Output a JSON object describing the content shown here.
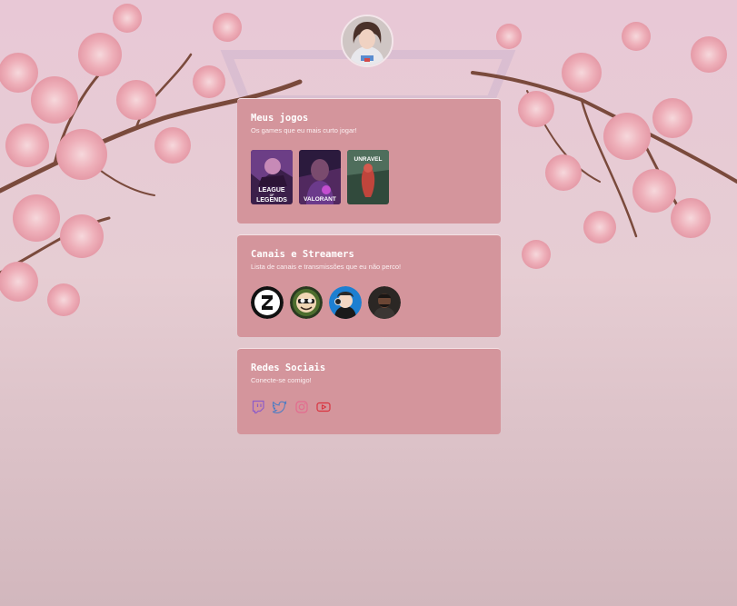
{
  "colors": {
    "card_bg": "#d4959c",
    "page_bg": "#d4b8bf",
    "twitch": "#8d5cc8",
    "twitter": "#4a7cc4",
    "instagram": "#e36b8e",
    "youtube": "#d9343f"
  },
  "profile": {
    "avatar_icon": "profile-avatar"
  },
  "games_card": {
    "title": "Meus jogos",
    "subtitle": "Os games que eu mais curto jogar!",
    "games": [
      {
        "name": "League of Legends",
        "logo_line1": "LEAGUE",
        "logo_line2": "LEGENDS",
        "logo_small": "OF"
      },
      {
        "name": "Valorant",
        "logo": "VALORANT"
      },
      {
        "name": "Unravel",
        "logo": "UNRAVEL"
      }
    ]
  },
  "streamers_card": {
    "title": "Canais e Streamers",
    "subtitle": "Lista de canais e transmissões que eu não perco!",
    "channels": [
      "channel-1",
      "channel-2",
      "channel-3",
      "channel-4"
    ]
  },
  "social_card": {
    "title": "Redes Sociais",
    "subtitle": "Conecte-se comigo!",
    "icons": [
      "twitch-icon",
      "twitter-icon",
      "instagram-icon",
      "youtube-icon"
    ]
  }
}
